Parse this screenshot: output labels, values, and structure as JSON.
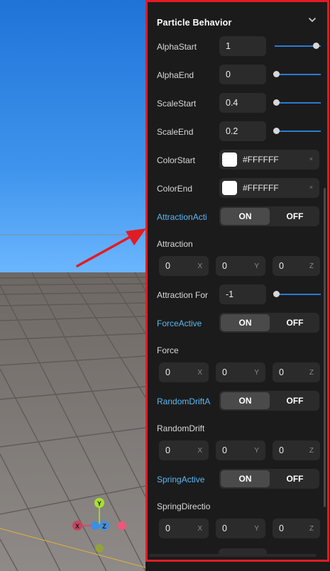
{
  "panel": {
    "title": "Particle Behavior",
    "rows": {
      "alpha_start": {
        "label": "AlphaStart",
        "value": "1",
        "slider": 1.0
      },
      "alpha_end": {
        "label": "AlphaEnd",
        "value": "0",
        "slider": 0.0
      },
      "scale_start": {
        "label": "ScaleStart",
        "value": "0.4",
        "slider": 0.0
      },
      "scale_end": {
        "label": "ScaleEnd",
        "value": "0.2",
        "slider": 0.0
      },
      "color_start": {
        "label": "ColorStart",
        "value": "#FFFFFF",
        "clear": "×"
      },
      "color_end": {
        "label": "ColorEnd",
        "value": "#FFFFFF",
        "clear": "×"
      },
      "attraction_active": {
        "label": "AttractionActi",
        "on": "ON",
        "off": "OFF"
      },
      "attraction": {
        "label": "Attraction",
        "x": "0",
        "y": "0",
        "z": "0"
      },
      "attraction_force": {
        "label": "Attraction For",
        "value": "-1",
        "slider": 0.0
      },
      "force_active": {
        "label": "ForceActive",
        "on": "ON",
        "off": "OFF"
      },
      "force": {
        "label": "Force",
        "x": "0",
        "y": "0",
        "z": "0"
      },
      "random_drift_active": {
        "label": "RandomDriftA",
        "on": "ON",
        "off": "OFF"
      },
      "random_drift": {
        "label": "RandomDrift",
        "x": "0",
        "y": "0",
        "z": "0"
      },
      "spring_active": {
        "label": "SpringActive",
        "on": "ON",
        "off": "OFF"
      },
      "spring_direction": {
        "label": "SpringDirectio",
        "x": "0",
        "y": "0",
        "z": "0"
      }
    },
    "axis_labels": {
      "x": "X",
      "y": "Y",
      "z": "Z"
    }
  },
  "gizmo": {
    "x": "X",
    "y": "Y",
    "z": "Z"
  },
  "colors": {
    "panel_bg": "#1b1b1b",
    "field_bg": "#2b2b2b",
    "highlight_border": "#e31b23",
    "accent_blue": "#5ab8f2",
    "slider_blue": "#2b7bd1",
    "arrow": "#e31b23"
  }
}
